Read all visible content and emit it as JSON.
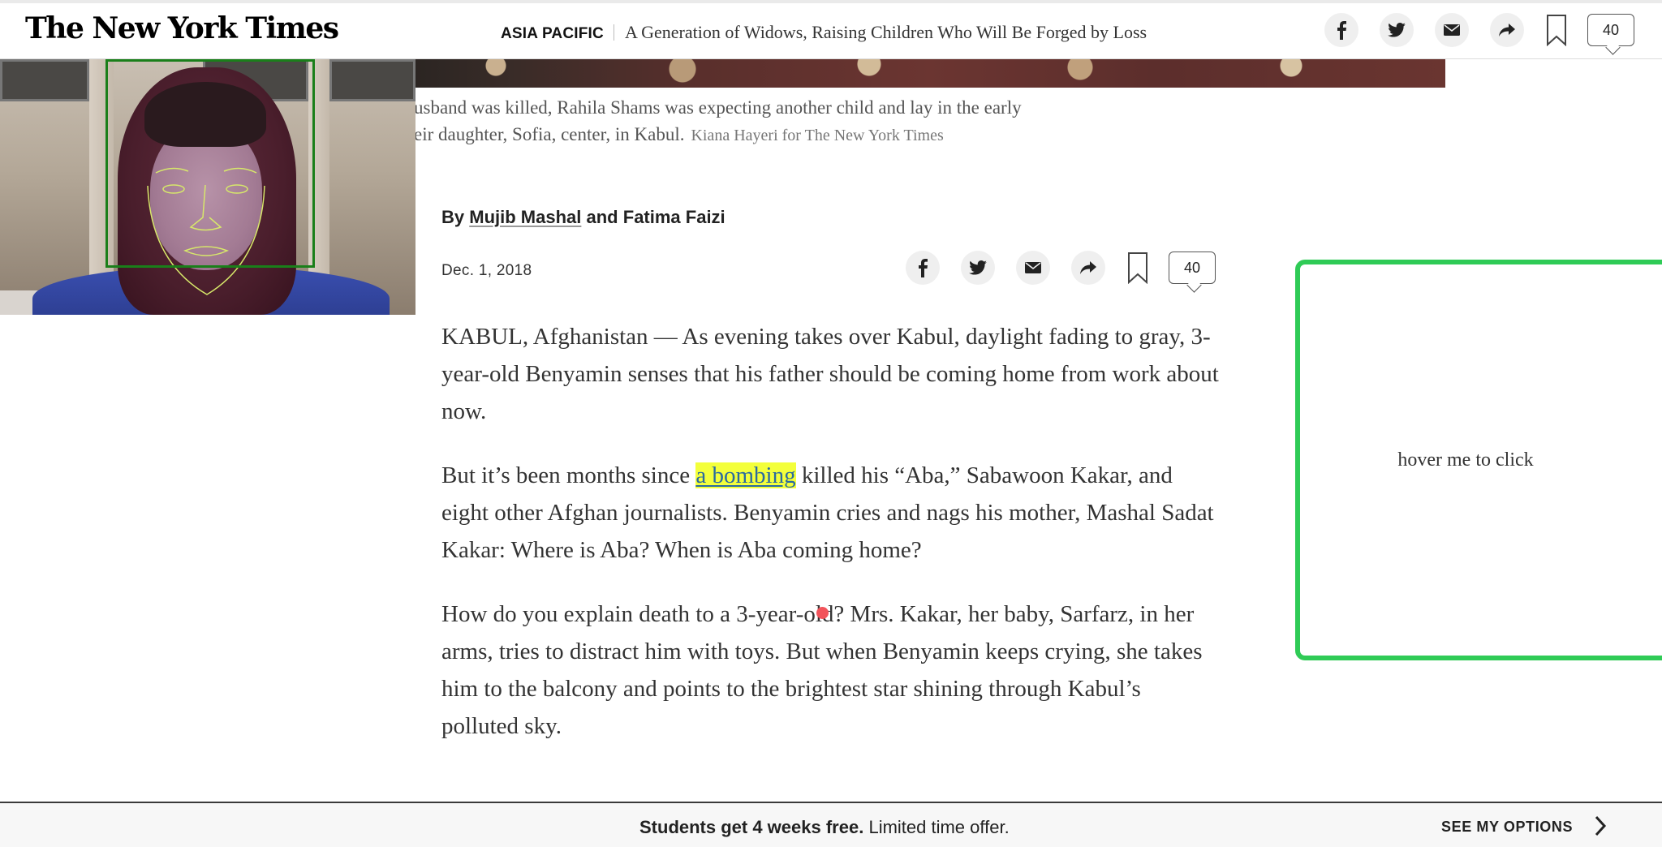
{
  "header": {
    "logo": "The New York Times",
    "section": "ASIA PACIFIC",
    "headline": "A Generation of Widows, Raising Children Who Will Be Forged by Loss",
    "comment_count": "40"
  },
  "caption": {
    "line1": "usband was killed, Rahila Shams was expecting another child and lay in the early",
    "line2": "eir daughter, Sofia, center, in Kabul.",
    "credit": "Kiana Hayeri for The New York Times"
  },
  "byline": {
    "prefix": "By",
    "author1": "Mujib Mashal",
    "conjunction": "and",
    "author2": "Fatima Faizi"
  },
  "dateline": "Dec. 1, 2018",
  "article_share": {
    "comment_count": "40"
  },
  "story": {
    "p1": "KABUL, Afghanistan — As evening takes over Kabul, daylight fading to gray, 3-year-old Benyamin senses that his father should be coming home from work about now.",
    "p2_before": "But it’s been months since ",
    "p2_link": "a bombing",
    "p2_after": " killed his “Aba,” Sabawoon Kakar, and eight other Afghan journalists. Benyamin cries and nags his mother, Mashal Sadat Kakar: Where is Aba? When is Aba coming home?",
    "p3": "How do you explain death to a 3-year-old? Mrs. Kakar, her baby, Sarfarz, in her arms, tries to distract him with toys. But when Benyamin keeps crying, she takes him to the balcony and points to the brightest star shining through Kabul’s polluted sky."
  },
  "hover_box": {
    "label": "hover me to click",
    "border_color": "#2fcb56"
  },
  "banner": {
    "offer_bold": "Students get 4 weeks free.",
    "offer_rest": "Limited time offer.",
    "cta": "SEE MY OPTIONS"
  },
  "colors": {
    "link_highlight": "#f3ff3b",
    "cursor_dot": "#f2545b",
    "face_box": "#1a7f1a"
  },
  "icons": [
    "facebook-icon",
    "twitter-icon",
    "email-icon",
    "share-icon",
    "bookmark-icon",
    "comments-icon",
    "chevron-right-icon"
  ]
}
